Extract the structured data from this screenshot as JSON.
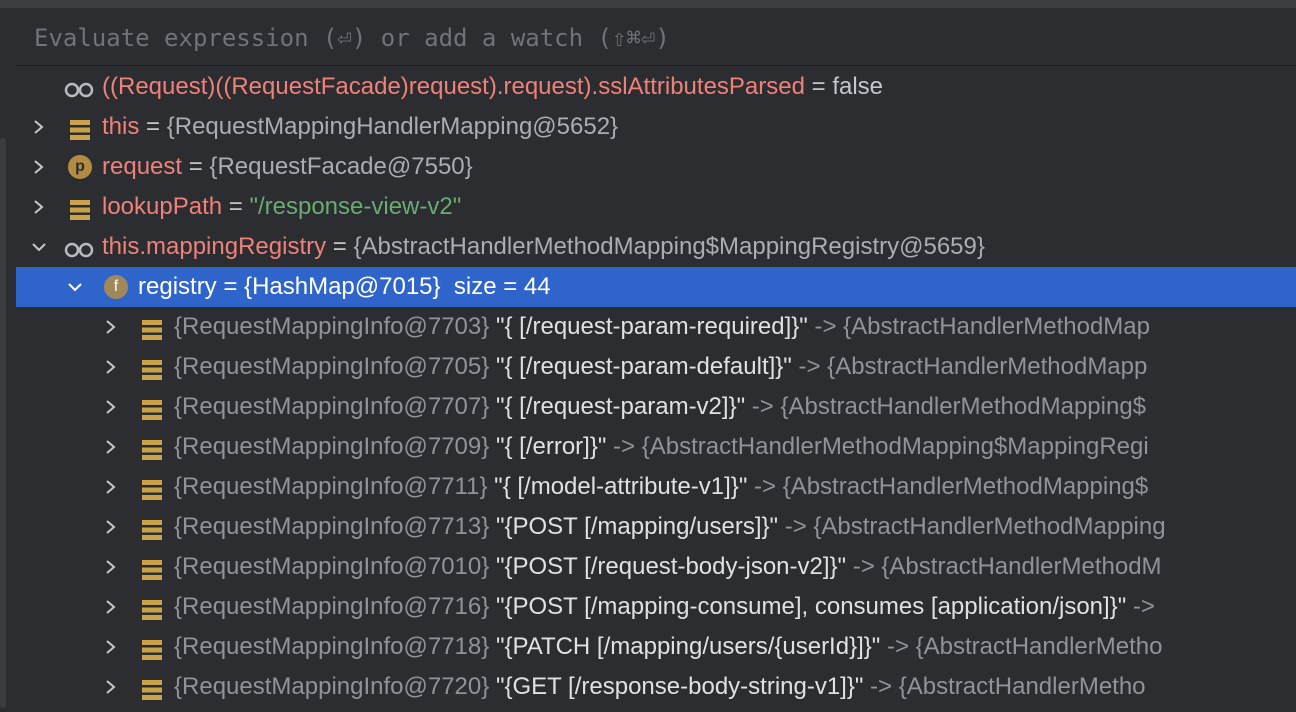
{
  "evaluate": {
    "placeholder": "Evaluate expression (⏎) or add a watch (⇧⌘⏎)"
  },
  "watch": {
    "expr": "((Request)((RequestFacade)request).request).sslAttributesParsed",
    "eq": " = ",
    "value": "false",
    "icon": "watch-glasses-icon"
  },
  "vars": [
    {
      "name": "this",
      "eq": " = ",
      "value": "{RequestMappingHandlerMapping@5652}",
      "icon": "field-stack-icon"
    },
    {
      "name": "request",
      "eq": " = ",
      "value": "{RequestFacade@7550}",
      "icon": "parameter-icon",
      "badge": "p"
    },
    {
      "name": "lookupPath",
      "eq": " = ",
      "value": "\"/response-view-v2\"",
      "icon": "field-stack-icon"
    },
    {
      "name": "this.mappingRegistry",
      "eq": " = ",
      "value": "{AbstractHandlerMethodMapping$MappingRegistry@5659}",
      "icon": "watch-glasses-icon"
    }
  ],
  "selected": {
    "name": "registry",
    "eq": " = ",
    "value": "{HashMap@7015}",
    "size": "  size = 44",
    "badge": "f",
    "icon": "field-icon"
  },
  "entries": [
    {
      "key": "{RequestMappingInfo@7703}",
      "str": "\"{ [/request-param-required]}\"",
      "arrow": " -> ",
      "value": "{AbstractHandlerMethodMap"
    },
    {
      "key": "{RequestMappingInfo@7705}",
      "str": "\"{ [/request-param-default]}\"",
      "arrow": " -> ",
      "value": "{AbstractHandlerMethodMapp"
    },
    {
      "key": "{RequestMappingInfo@7707}",
      "str": "\"{ [/request-param-v2]}\"",
      "arrow": " -> ",
      "value": "{AbstractHandlerMethodMapping$"
    },
    {
      "key": "{RequestMappingInfo@7709}",
      "str": "\"{ [/error]}\"",
      "arrow": " -> ",
      "value": "{AbstractHandlerMethodMapping$MappingRegi"
    },
    {
      "key": "{RequestMappingInfo@7711}",
      "str": "\"{ [/model-attribute-v1]}\"",
      "arrow": " -> ",
      "value": "{AbstractHandlerMethodMapping$"
    },
    {
      "key": "{RequestMappingInfo@7713}",
      "str": "\"{POST [/mapping/users]}\"",
      "arrow": " -> ",
      "value": "{AbstractHandlerMethodMapping"
    },
    {
      "key": "{RequestMappingInfo@7010}",
      "str": "\"{POST [/request-body-json-v2]}\"",
      "arrow": " -> ",
      "value": "{AbstractHandlerMethodM"
    },
    {
      "key": "{RequestMappingInfo@7716}",
      "str": "\"{POST [/mapping-consume], consumes [application/json]}\"",
      "arrow": " ->",
      "value": ""
    },
    {
      "key": "{RequestMappingInfo@7718}",
      "str": "\"{PATCH [/mapping/users/{userId}]}\"",
      "arrow": " -> ",
      "value": "{AbstractHandlerMetho"
    },
    {
      "key": "{RequestMappingInfo@7720}",
      "str": "\"{GET [/response-body-string-v1]}\"",
      "arrow": " -> ",
      "value": "{AbstractHandlerMetho"
    }
  ],
  "colors": {
    "background": "#2b2d30",
    "selection": "#2f65ca",
    "name": "#f0817a",
    "string": "#6aab73",
    "value": "#a9adb4",
    "icon": "#c9a24a"
  }
}
